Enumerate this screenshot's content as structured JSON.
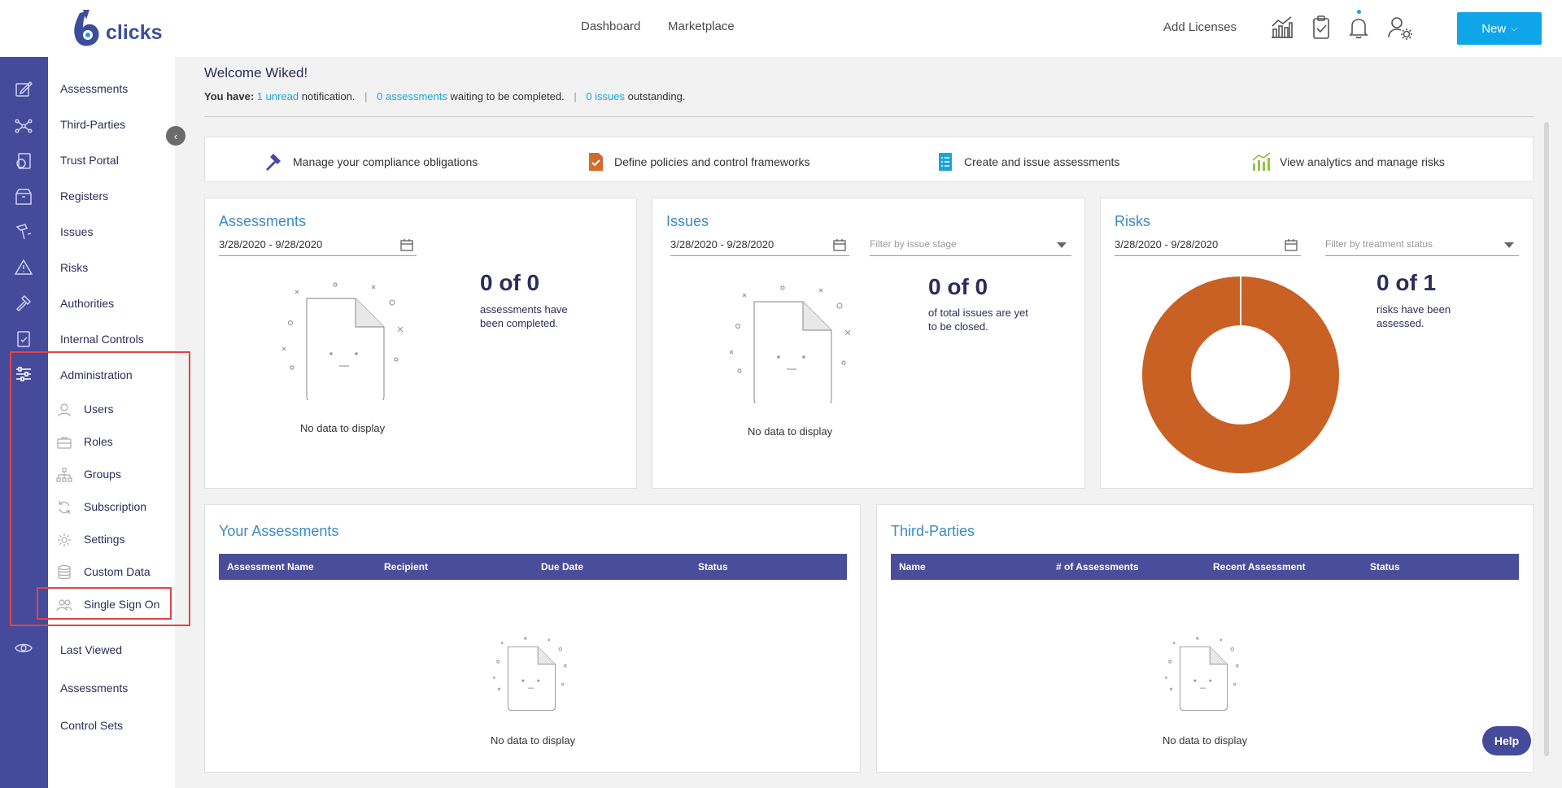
{
  "brand": {
    "name": "clicks"
  },
  "topnav": {
    "dashboard": "Dashboard",
    "marketplace": "Marketplace",
    "add_licenses": "Add Licenses",
    "new_button": "New"
  },
  "rail_icons": [
    "edit-icon",
    "share-nodes-icon",
    "shield-icon",
    "box-icon",
    "hammer-icon",
    "warning-icon",
    "gavel-icon",
    "clipboard-check-icon",
    "sliders-icon",
    "eye-icon"
  ],
  "sidebar": {
    "items": [
      {
        "label": "Assessments"
      },
      {
        "label": "Third-Parties"
      },
      {
        "label": "Trust Portal"
      },
      {
        "label": "Registers"
      },
      {
        "label": "Issues"
      },
      {
        "label": "Risks"
      },
      {
        "label": "Authorities"
      },
      {
        "label": "Internal Controls"
      },
      {
        "label": "Administration"
      }
    ],
    "admin_sub": [
      {
        "label": "Users",
        "icon": "user-icon"
      },
      {
        "label": "Roles",
        "icon": "briefcase-icon"
      },
      {
        "label": "Groups",
        "icon": "org-chart-icon"
      },
      {
        "label": "Subscription",
        "icon": "refresh-icon"
      },
      {
        "label": "Settings",
        "icon": "gear-icon"
      },
      {
        "label": "Custom Data",
        "icon": "database-icon"
      },
      {
        "label": "Single Sign On",
        "icon": "users-icon"
      }
    ],
    "last_viewed": "Last Viewed",
    "recent": [
      {
        "label": "Assessments"
      },
      {
        "label": "Control Sets"
      }
    ]
  },
  "welcome": {
    "title": "Welcome Wiked!",
    "you_have": "You have:",
    "unread": "1 unread",
    "notification": "notification.",
    "assessments_link": "0 assessments",
    "assessments_rest": "waiting to be completed.",
    "issues_link": "0 issues",
    "issues_rest": "outstanding."
  },
  "features": [
    {
      "label": "Manage your compliance obligations"
    },
    {
      "label": "Define policies and control frameworks"
    },
    {
      "label": "Create and issue assessments"
    },
    {
      "label": "View analytics and manage risks"
    }
  ],
  "cards": {
    "assessments": {
      "title": "Assessments",
      "date_range": "3/28/2020 - 9/28/2020",
      "big": "0 of 0",
      "sub": "assessments have been completed.",
      "nodata": "No data to display"
    },
    "issues": {
      "title": "Issues",
      "date_range": "3/28/2020 - 9/28/2020",
      "filter": "Filter by issue stage",
      "big": "0 of 0",
      "sub": "of total issues are yet to be closed.",
      "nodata": "No data to display"
    },
    "risks": {
      "title": "Risks",
      "date_range": "3/28/2020 - 9/28/2020",
      "filter": "Filter by treatment status",
      "big": "0 of 1",
      "sub": "risks have been assessed.",
      "donut_color": "#c86123"
    }
  },
  "your_assessments": {
    "title": "Your Assessments",
    "columns": [
      "Assessment Name",
      "Recipient",
      "Due Date",
      "Status"
    ],
    "nodata": "No data to display"
  },
  "third_parties": {
    "title": "Third-Parties",
    "columns": [
      "Name",
      "# of Assessments",
      "Recent Assessment",
      "Status"
    ],
    "nodata": "No data to display"
  },
  "help": "Help",
  "colors": {
    "rail": "#454a9a",
    "accent": "#0ea5e9",
    "link": "#1ea3d9",
    "table_head": "#4a4e9a",
    "highlight": "#e04545"
  }
}
